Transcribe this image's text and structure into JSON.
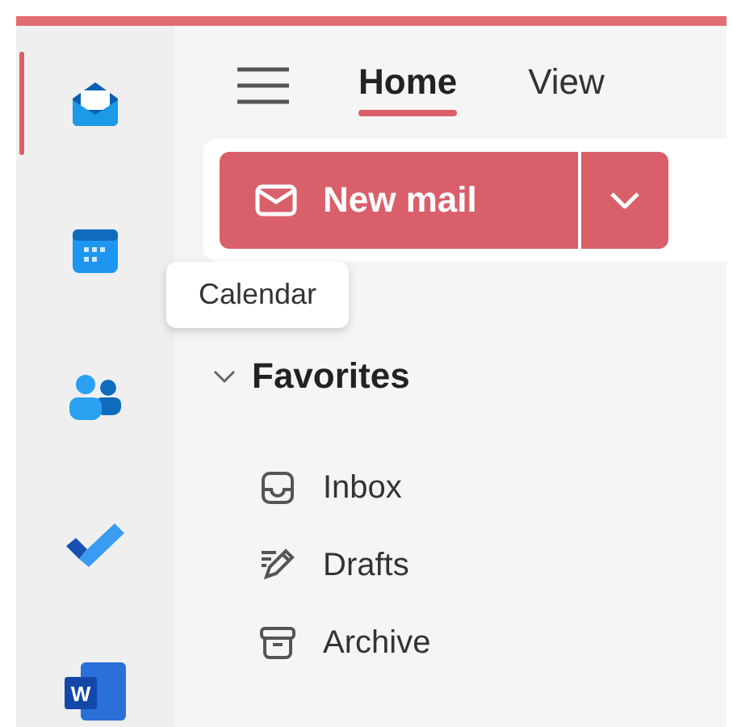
{
  "apps": [
    {
      "kind": "mail",
      "selected": true
    },
    {
      "kind": "calendar",
      "selected": false
    },
    {
      "kind": "people",
      "selected": false
    },
    {
      "kind": "todo",
      "selected": false
    },
    {
      "kind": "word",
      "selected": false,
      "letter": "W"
    }
  ],
  "tabs": [
    {
      "label": "Home",
      "selected": true
    },
    {
      "label": "View",
      "selected": false
    }
  ],
  "ribbon": {
    "new_mail": "New mail"
  },
  "tooltip": "Calendar",
  "favorites": {
    "title": "Favorites",
    "expanded": true,
    "items": [
      {
        "kind": "inbox",
        "label": "Inbox"
      },
      {
        "kind": "drafts",
        "label": "Drafts"
      },
      {
        "kind": "archive",
        "label": "Archive"
      }
    ]
  }
}
